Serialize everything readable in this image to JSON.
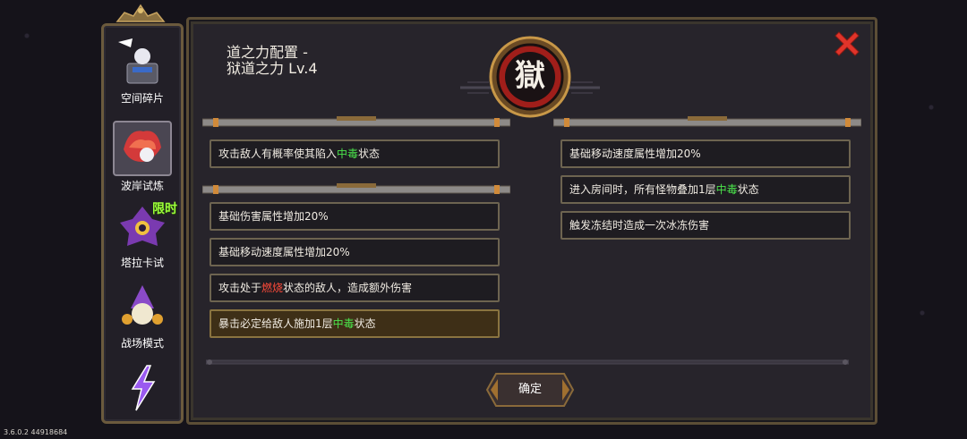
{
  "version": "3.6.0.2 44918684",
  "sidebar": {
    "items": [
      {
        "label": "空间碎片",
        "icon": "space-fragment-icon"
      },
      {
        "label": "波岸试炼",
        "icon": "wave-trial-icon"
      },
      {
        "label": "塔拉卡试",
        "icon": "taraka-trial-icon",
        "badge": "限时"
      },
      {
        "label": "战场模式",
        "icon": "battlefield-mode-icon"
      },
      {
        "label": "",
        "icon": "lightning-mode-icon"
      }
    ]
  },
  "panel": {
    "title_line1": "道之力配置 -",
    "title_line2": "狱道之力 Lv.4",
    "emblem_char": "獄",
    "confirm_label": "确定"
  },
  "left_group1": [
    {
      "parts": [
        [
          "攻击敌人有概率使其陷入",
          ""
        ],
        [
          "中毒",
          "green"
        ],
        [
          "状态",
          ""
        ]
      ]
    }
  ],
  "left_group2": [
    {
      "parts": [
        [
          "基础伤害属性增加20%",
          ""
        ]
      ]
    },
    {
      "parts": [
        [
          "基础移动速度属性增加20%",
          ""
        ]
      ]
    },
    {
      "parts": [
        [
          "攻击处于",
          ""
        ],
        [
          "燃烧",
          "red"
        ],
        [
          "状态的敌人，造成额外伤害",
          ""
        ]
      ]
    },
    {
      "parts": [
        [
          "暴击必定给敌人施加1层",
          ""
        ],
        [
          "中毒",
          "green"
        ],
        [
          "状态",
          ""
        ]
      ],
      "selected": true
    }
  ],
  "right_group": [
    {
      "parts": [
        [
          "基础移动速度属性增加20%",
          ""
        ]
      ]
    },
    {
      "parts": [
        [
          "进入房间时，所有怪物叠加1层",
          ""
        ],
        [
          "中毒",
          "green"
        ],
        [
          "状态",
          ""
        ]
      ]
    },
    {
      "parts": [
        [
          "触发冻结时造成一次冰冻伤害",
          ""
        ]
      ]
    }
  ],
  "colors": {
    "accent_green": "#4be34b",
    "accent_red": "#ff4b3a",
    "frame_gold": "#b08a4a"
  }
}
